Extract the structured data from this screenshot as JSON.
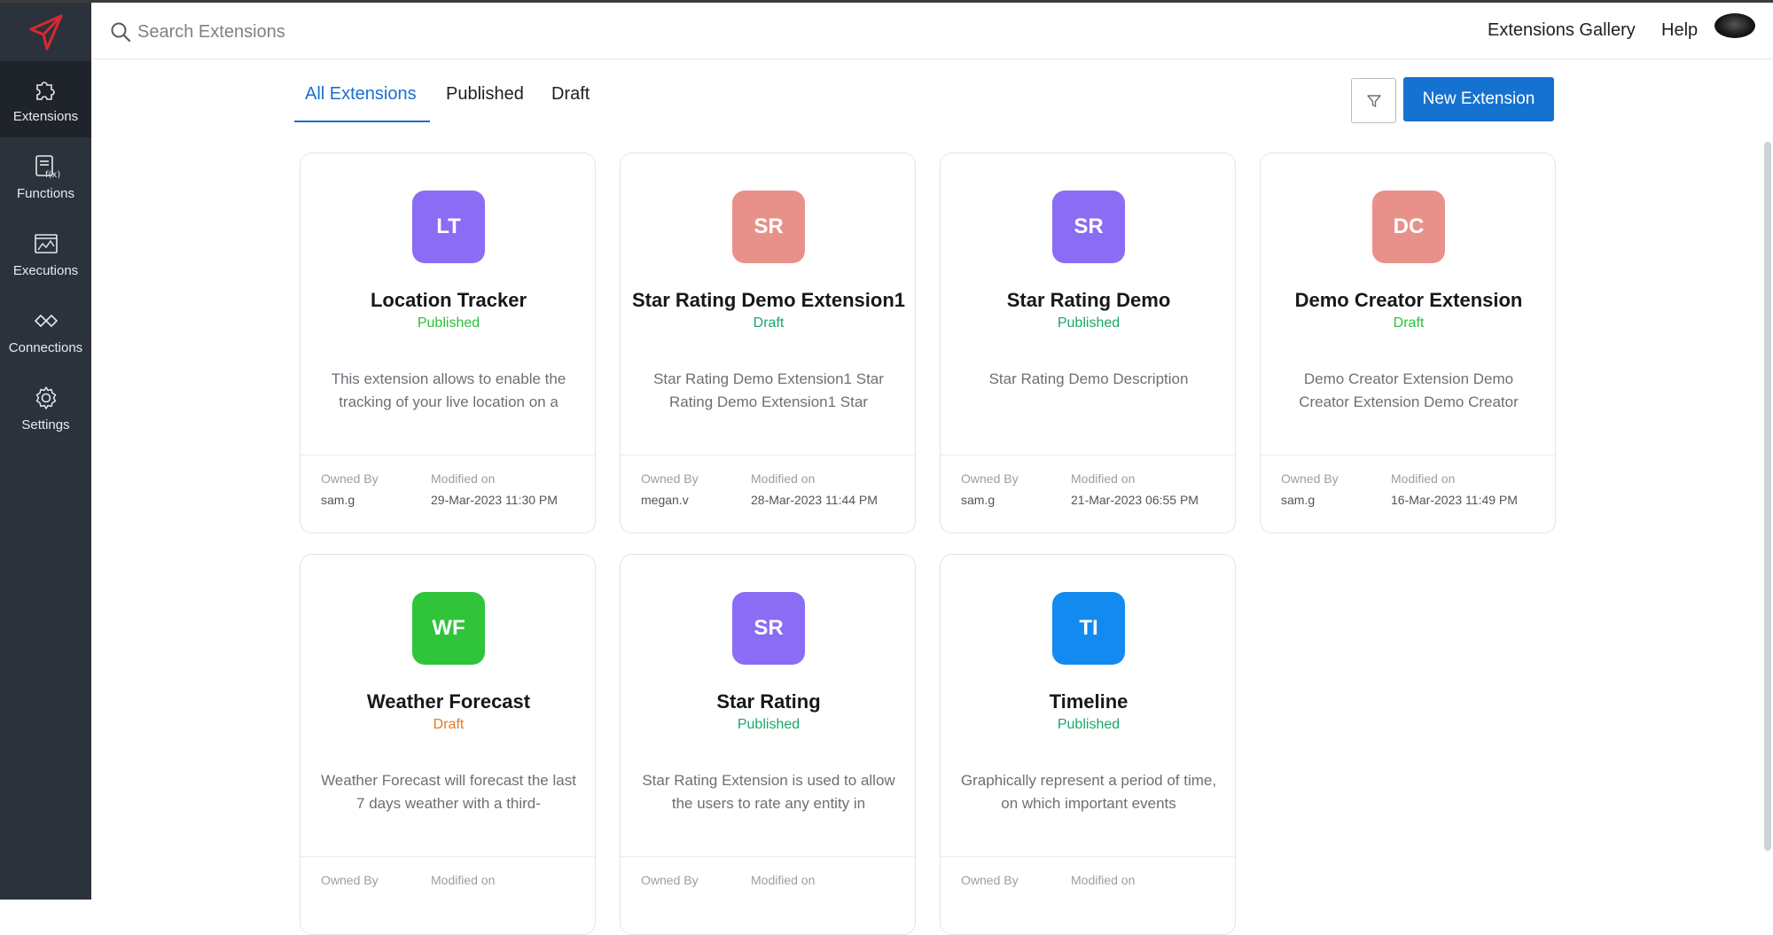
{
  "colors": {
    "sidebar": "#2c323c",
    "accent": "#1672d0",
    "published": "#1aa56b",
    "draft_green": "#2bbd3a",
    "draft_orange": "#e07a1f",
    "avatar_purple": "#8a6cf5",
    "avatar_salmon": "#e8918a",
    "avatar_green": "#2fc43a",
    "avatar_blue": "#128af0"
  },
  "sidebar": {
    "items": [
      {
        "label": "Extensions",
        "icon": "puzzle-icon"
      },
      {
        "label": "Functions",
        "icon": "function-icon"
      },
      {
        "label": "Executions",
        "icon": "executions-icon"
      },
      {
        "label": "Connections",
        "icon": "connections-icon"
      },
      {
        "label": "Settings",
        "icon": "gear-icon"
      }
    ]
  },
  "header": {
    "search_placeholder": "Search Extensions",
    "gallery_link": "Extensions Gallery",
    "help_link": "Help"
  },
  "tabs": {
    "all": "All Extensions",
    "published": "Published",
    "draft": "Draft"
  },
  "toolbar": {
    "new_extension": "New Extension"
  },
  "card_labels": {
    "owned_by": "Owned By",
    "modified_on": "Modified on"
  },
  "cards": [
    {
      "initials": "LT",
      "title": "Location Tracker",
      "status": "Published",
      "desc": "This extension allows to enable the tracking of your live location on a",
      "owner": "sam.g",
      "modified": "29-Mar-2023 11:30 PM"
    },
    {
      "initials": "SR",
      "title": "Star Rating Demo Extension1",
      "status": "Draft",
      "desc": "Star Rating Demo Extension1 Star Rating Demo Extension1 Star",
      "owner": "megan.v",
      "modified": "28-Mar-2023 11:44 PM"
    },
    {
      "initials": "SR",
      "title": "Star Rating Demo",
      "status": "Published",
      "desc": "Star Rating Demo Description",
      "owner": "sam.g",
      "modified": "21-Mar-2023 06:55 PM"
    },
    {
      "initials": "DC",
      "title": "Demo Creator Extension",
      "status": "Draft",
      "desc": "Demo Creator Extension Demo Creator Extension Demo Creator",
      "owner": "sam.g",
      "modified": "16-Mar-2023 11:49 PM"
    },
    {
      "initials": "WF",
      "title": "Weather Forecast",
      "status": "Draft",
      "desc": "Weather Forecast will forecast the last 7 days weather with a third-",
      "owner": "",
      "modified": ""
    },
    {
      "initials": "SR",
      "title": "Star Rating",
      "status": "Published",
      "desc": "Star Rating Extension is used to allow the users to rate any entity in",
      "owner": "",
      "modified": ""
    },
    {
      "initials": "TI",
      "title": "Timeline",
      "status": "Published",
      "desc": "Graphically represent a period of time, on which important events",
      "owner": "",
      "modified": ""
    }
  ]
}
